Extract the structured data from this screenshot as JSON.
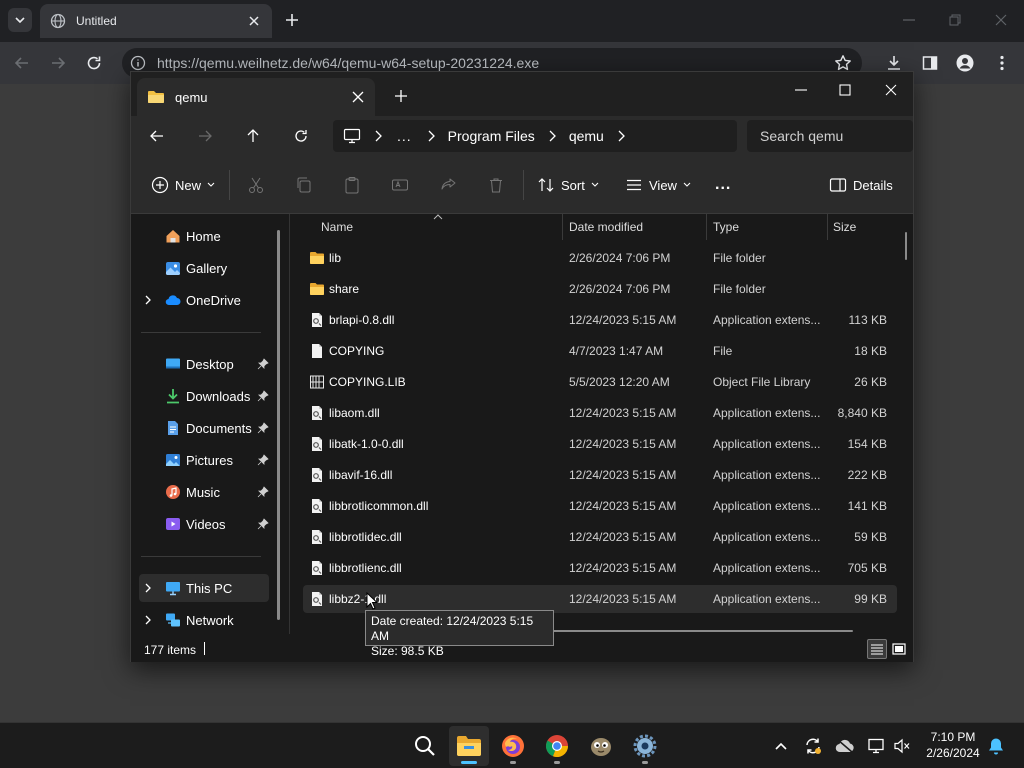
{
  "browser": {
    "tab_title": "Untitled",
    "url": "https://qemu.weilnetz.de/w64/qemu-w64-setup-20231224.exe"
  },
  "explorer": {
    "tab_title": "qemu",
    "breadcrumb": {
      "overflow": "...",
      "segments": [
        "Program Files",
        "qemu"
      ]
    },
    "search_placeholder": "Search qemu",
    "commands": {
      "new": "New",
      "sort": "Sort",
      "view": "View",
      "more": "...",
      "details": "Details"
    },
    "nav": {
      "home": "Home",
      "gallery": "Gallery",
      "onedrive": "OneDrive",
      "desktop": "Desktop",
      "downloads": "Downloads",
      "documents": "Documents",
      "pictures": "Pictures",
      "music": "Music",
      "videos": "Videos",
      "this_pc": "This PC",
      "network": "Network"
    },
    "columns": {
      "name": "Name",
      "date": "Date modified",
      "type": "Type",
      "size": "Size"
    },
    "files": [
      {
        "name": "lib",
        "date": "2/26/2024 7:06 PM",
        "type": "File folder",
        "size": "",
        "icon": "folder-icon"
      },
      {
        "name": "share",
        "date": "2/26/2024 7:06 PM",
        "type": "File folder",
        "size": "",
        "icon": "folder-icon"
      },
      {
        "name": "brlapi-0.8.dll",
        "date": "12/24/2023 5:15 AM",
        "type": "Application extens...",
        "size": "113 KB",
        "icon": "dll-icon"
      },
      {
        "name": "COPYING",
        "date": "4/7/2023 1:47 AM",
        "type": "File",
        "size": "18 KB",
        "icon": "file-icon"
      },
      {
        "name": "COPYING.LIB",
        "date": "5/5/2023 12:20 AM",
        "type": "Object File Library",
        "size": "26 KB",
        "icon": "lib-icon"
      },
      {
        "name": "libaom.dll",
        "date": "12/24/2023 5:15 AM",
        "type": "Application extens...",
        "size": "8,840 KB",
        "icon": "dll-icon"
      },
      {
        "name": "libatk-1.0-0.dll",
        "date": "12/24/2023 5:15 AM",
        "type": "Application extens...",
        "size": "154 KB",
        "icon": "dll-icon"
      },
      {
        "name": "libavif-16.dll",
        "date": "12/24/2023 5:15 AM",
        "type": "Application extens...",
        "size": "222 KB",
        "icon": "dll-icon"
      },
      {
        "name": "libbrotlicommon.dll",
        "date": "12/24/2023 5:15 AM",
        "type": "Application extens...",
        "size": "141 KB",
        "icon": "dll-icon"
      },
      {
        "name": "libbrotlidec.dll",
        "date": "12/24/2023 5:15 AM",
        "type": "Application extens...",
        "size": "59 KB",
        "icon": "dll-icon"
      },
      {
        "name": "libbrotlienc.dll",
        "date": "12/24/2023 5:15 AM",
        "type": "Application extens...",
        "size": "705 KB",
        "icon": "dll-icon"
      },
      {
        "name": "libbz2-1.dll",
        "date": "12/24/2023 5:15 AM",
        "type": "Application extens...",
        "size": "99 KB",
        "icon": "dll-icon"
      }
    ],
    "tooltip": {
      "created": "Date created: 12/24/2023 5:15 AM",
      "size": "Size: 98.5 KB"
    },
    "status": {
      "item_count": "177 items"
    }
  },
  "taskbar": {
    "clock_time": "7:10 PM",
    "clock_date": "2/26/2024"
  },
  "colors": {
    "folder": "#f2c042",
    "accent": "#4cc2ff",
    "taskbar_indicator": "#4cc2ff"
  }
}
